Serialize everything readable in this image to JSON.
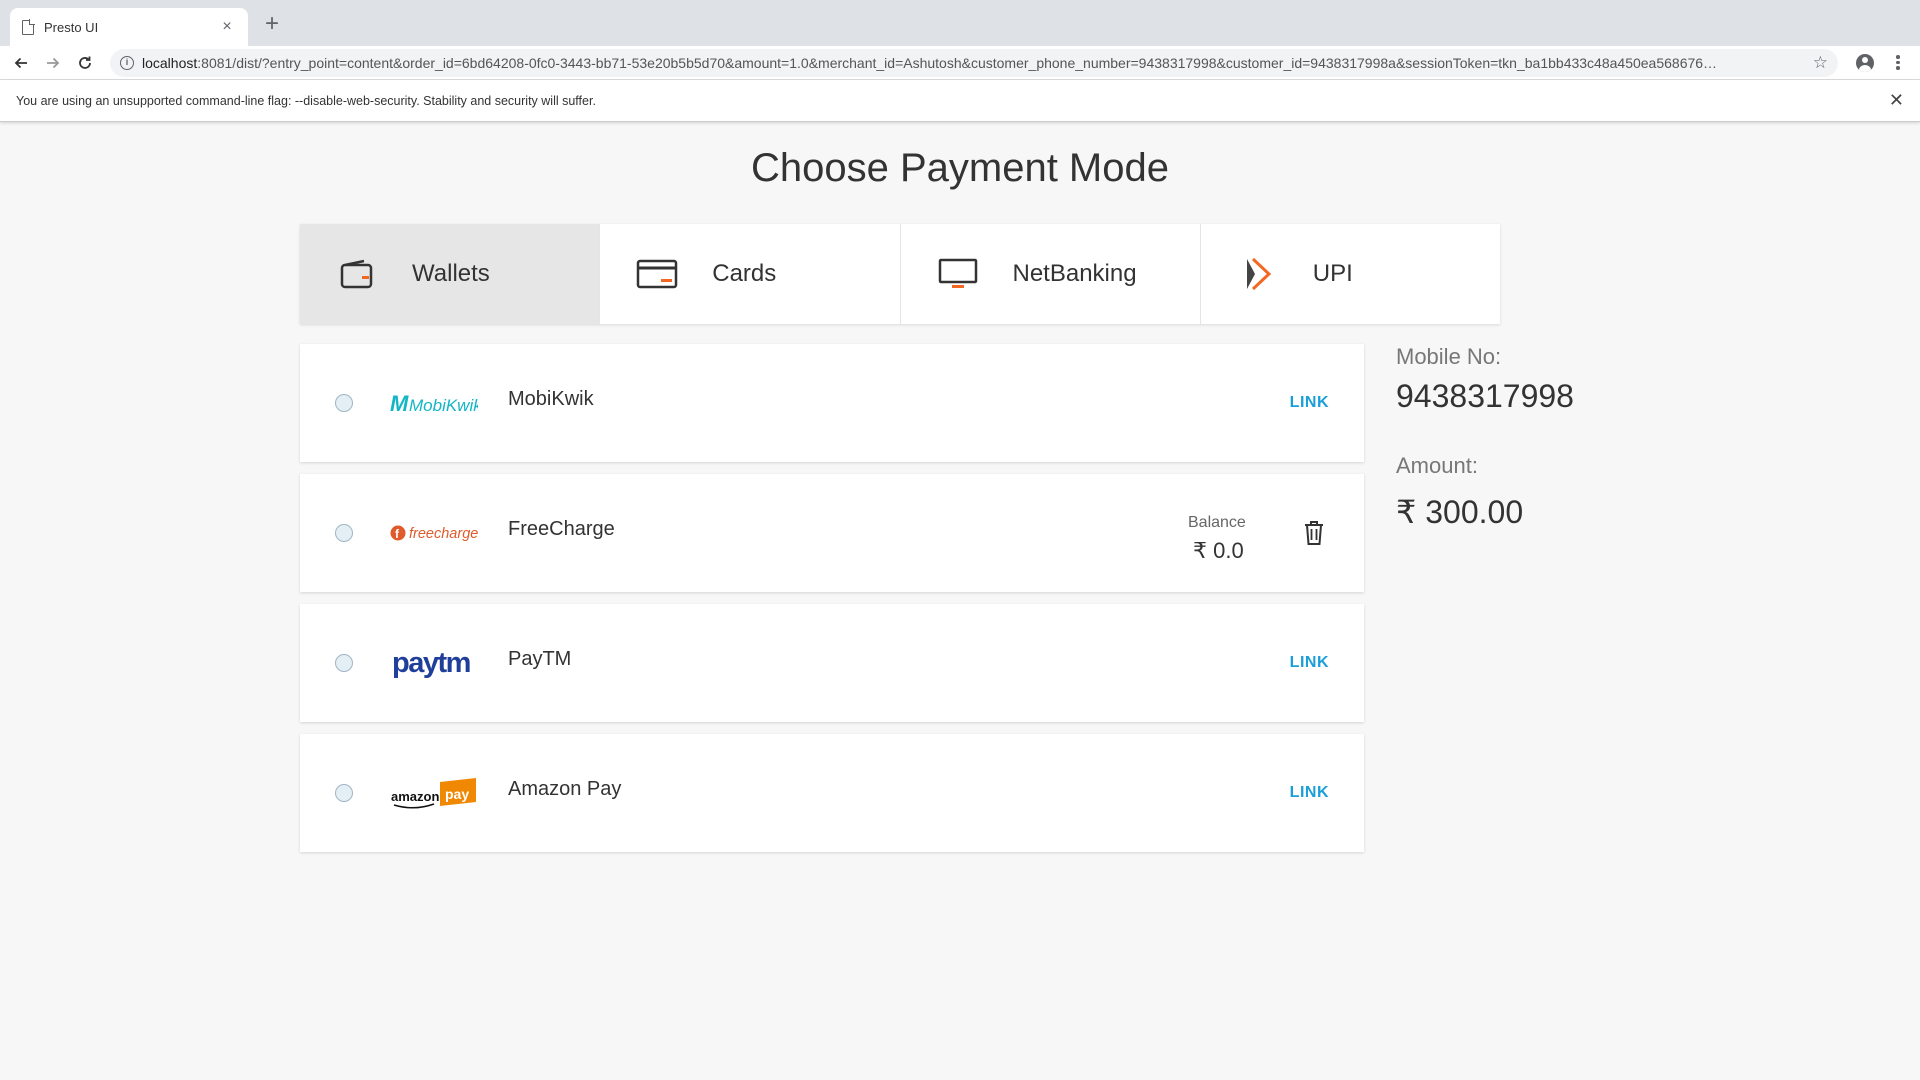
{
  "browser": {
    "tab_title": "Presto UI",
    "tab_close": "×",
    "new_tab": "+",
    "url_host": "localhost",
    "url_rest": ":8081/dist/?entry_point=content&order_id=6bd64208-0fc0-3443-bb71-53e20b5b5d70&amount=1.0&merchant_id=Ashutosh&customer_phone_number=9438317998&customer_id=9438317998a&sessionToken=tkn_ba1bb433c48a450ea568676…",
    "infobar_message": "You are using an unsupported command-line flag: --disable-web-security. Stability and security will suffer.",
    "infobar_close": "✕",
    "star": "☆"
  },
  "page": {
    "title": "Choose Payment Mode",
    "accent_color": "#1a9fd9"
  },
  "payment_tabs": [
    {
      "label": "Wallets",
      "icon": "wallet-icon",
      "active": true
    },
    {
      "label": "Cards",
      "icon": "card-icon",
      "active": false
    },
    {
      "label": "NetBanking",
      "icon": "monitor-icon",
      "active": false
    },
    {
      "label": "UPI",
      "icon": "upi-icon",
      "active": false
    }
  ],
  "wallets": [
    {
      "name": "MobiKwik",
      "logo_text": "MobiKwik",
      "action": "LINK"
    },
    {
      "name": "FreeCharge",
      "logo_text": "freecharge",
      "balance_label": "Balance",
      "balance_value": "₹ 0.0"
    },
    {
      "name": "PayTM",
      "logo_text": "paytm",
      "action": "LINK"
    },
    {
      "name": "Amazon Pay",
      "logo_text_1": "amazon",
      "logo_text_2": "pay",
      "action": "LINK"
    }
  ],
  "summary": {
    "mobile_label": "Mobile No:",
    "mobile_value": "9438317998",
    "amount_label": "Amount:",
    "amount_value": "₹ 300.00"
  }
}
